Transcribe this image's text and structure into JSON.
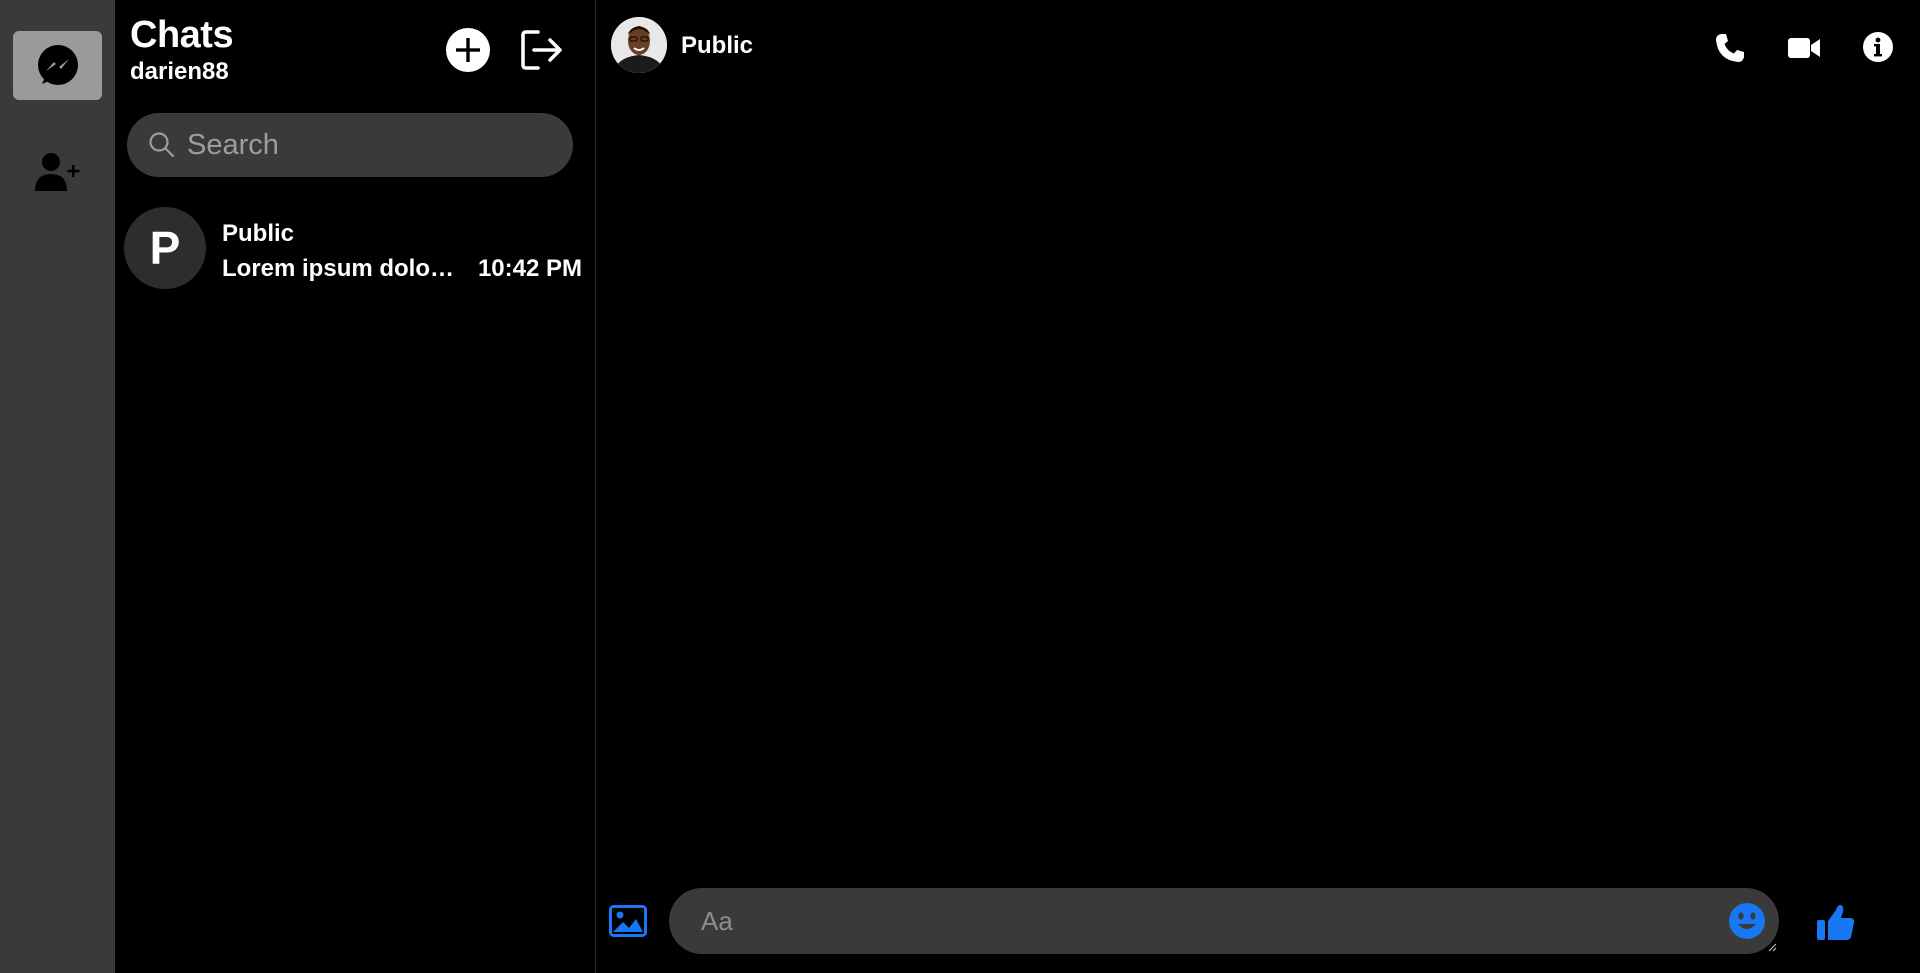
{
  "sidebar": {
    "items": [
      {
        "icon": "messenger-icon",
        "active": true
      },
      {
        "icon": "add-user-icon",
        "active": false
      }
    ]
  },
  "chats_panel": {
    "title": "Chats",
    "username": "darien88",
    "new_chat_icon": "plus-circle-icon",
    "logout_icon": "sign-out-icon",
    "search": {
      "placeholder": "Search",
      "value": ""
    },
    "conversations": [
      {
        "avatar_letter": "P",
        "name": "Public",
        "preview": "Lorem ipsum dolor sit amet",
        "time": "10:42 PM"
      }
    ]
  },
  "conversation": {
    "name": "Public",
    "header_icons": [
      "phone-icon",
      "video-icon",
      "info-icon"
    ],
    "composer": {
      "placeholder": "Aa",
      "value": "",
      "image_icon": "image-icon",
      "emoji_icon": "emoji-icon",
      "like_icon": "thumbs-up-icon"
    }
  },
  "colors": {
    "accent": "#1877f2",
    "rail_bg": "#3a3a3a",
    "rail_active": "#9a9a9a",
    "input_bg": "#3a3a3a",
    "background": "#000000"
  }
}
